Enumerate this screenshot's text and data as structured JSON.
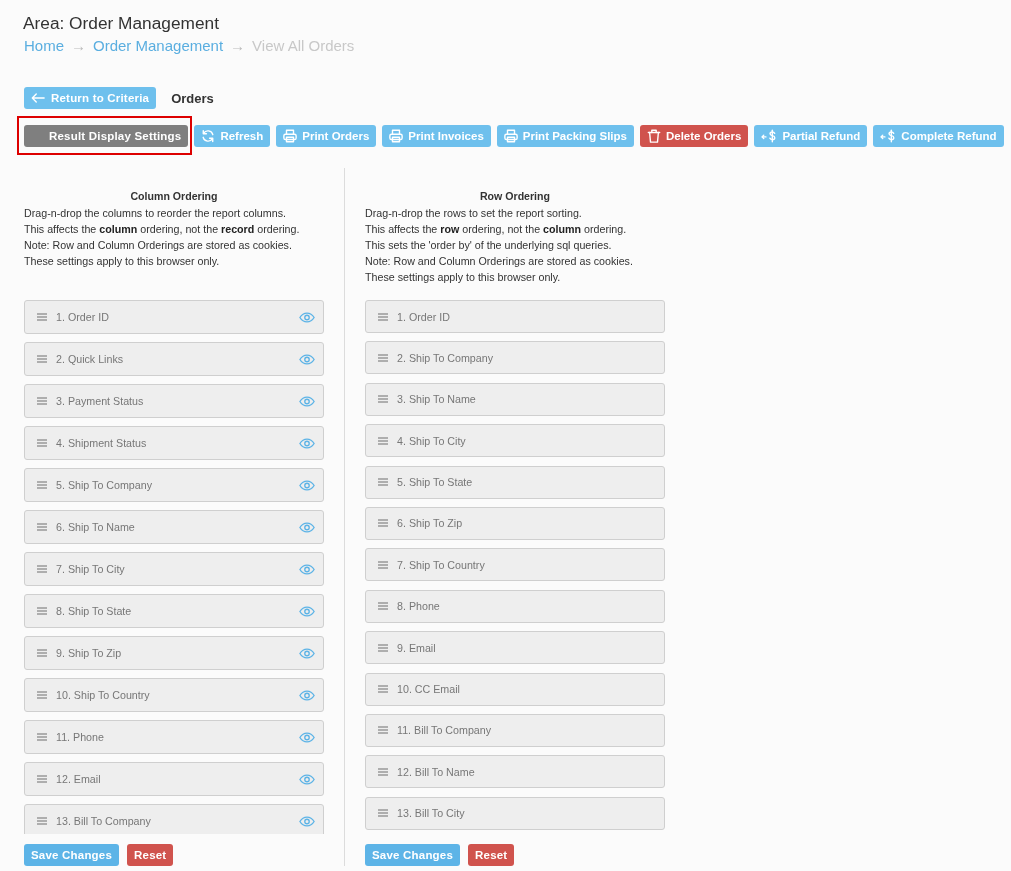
{
  "header": {
    "title": "Area: Order Management"
  },
  "breadcrumb": {
    "items": [
      {
        "label": "Home",
        "current": false
      },
      {
        "label": "Order Management",
        "current": false
      },
      {
        "label": "View All Orders",
        "current": true
      }
    ],
    "separators": [
      "→",
      "→"
    ]
  },
  "nav": {
    "back_button": "Return to Criteria",
    "section_label": "Orders"
  },
  "toolbar": [
    {
      "label": "Result Display Settings",
      "kind": "settings",
      "highlighted": true
    },
    {
      "label": "Refresh",
      "kind": "refresh",
      "highlighted": false
    },
    {
      "label": "Print Orders",
      "kind": "print",
      "highlighted": false
    },
    {
      "label": "Print Invoices",
      "kind": "print",
      "highlighted": false
    },
    {
      "label": "Print Packing Slips",
      "kind": "print",
      "highlighted": false
    },
    {
      "label": "Delete Orders",
      "kind": "delete",
      "highlighted": false
    },
    {
      "label": "Partial Refund",
      "kind": "refund",
      "highlighted": false
    },
    {
      "label": "Complete Refund",
      "kind": "refund",
      "highlighted": false
    }
  ],
  "column_ordering": {
    "title": "Column Ordering",
    "description": [
      "Drag-n-drop the columns to reorder the report columns.",
      "This affects the **column** ordering, not the **record** ordering.",
      "Note: Row and Column Orderings are stored as cookies.",
      "These settings apply to this browser only."
    ],
    "items": [
      {
        "label": "1. Order ID",
        "visible": true
      },
      {
        "label": "2. Quick Links",
        "visible": true
      },
      {
        "label": "3. Payment Status",
        "visible": true
      },
      {
        "label": "4. Shipment Status",
        "visible": true
      },
      {
        "label": "5. Ship To Company",
        "visible": true
      },
      {
        "label": "6. Ship To Name",
        "visible": true
      },
      {
        "label": "7. Ship To City",
        "visible": true
      },
      {
        "label": "8. Ship To State",
        "visible": true
      },
      {
        "label": "9. Ship To Zip",
        "visible": true
      },
      {
        "label": "10. Ship To Country",
        "visible": true
      },
      {
        "label": "11. Phone",
        "visible": true
      },
      {
        "label": "12. Email",
        "visible": true
      },
      {
        "label": "13. Bill To Company",
        "visible": true
      }
    ],
    "save_button": "Save Changes",
    "reset_button": "Reset"
  },
  "row_ordering": {
    "title": "Row Ordering",
    "description": [
      "Drag-n-drop the rows to set the report sorting.",
      "This affects the **row** ordering, not the **column** ordering.",
      "This sets the 'order by' of the underlying sql queries.",
      "Note: Row and Column Orderings are stored as cookies.",
      "These settings apply to this browser only."
    ],
    "items": [
      "1. Order ID",
      "2. Ship To Company",
      "3. Ship To Name",
      "4. Ship To City",
      "5. Ship To State",
      "6. Ship To Zip",
      "7. Ship To Country",
      "8. Phone",
      "9. Email",
      "10. CC Email",
      "11. Bill To Company",
      "12. Bill To Name",
      "13. Bill To City"
    ],
    "save_button": "Save Changes",
    "reset_button": "Reset"
  }
}
